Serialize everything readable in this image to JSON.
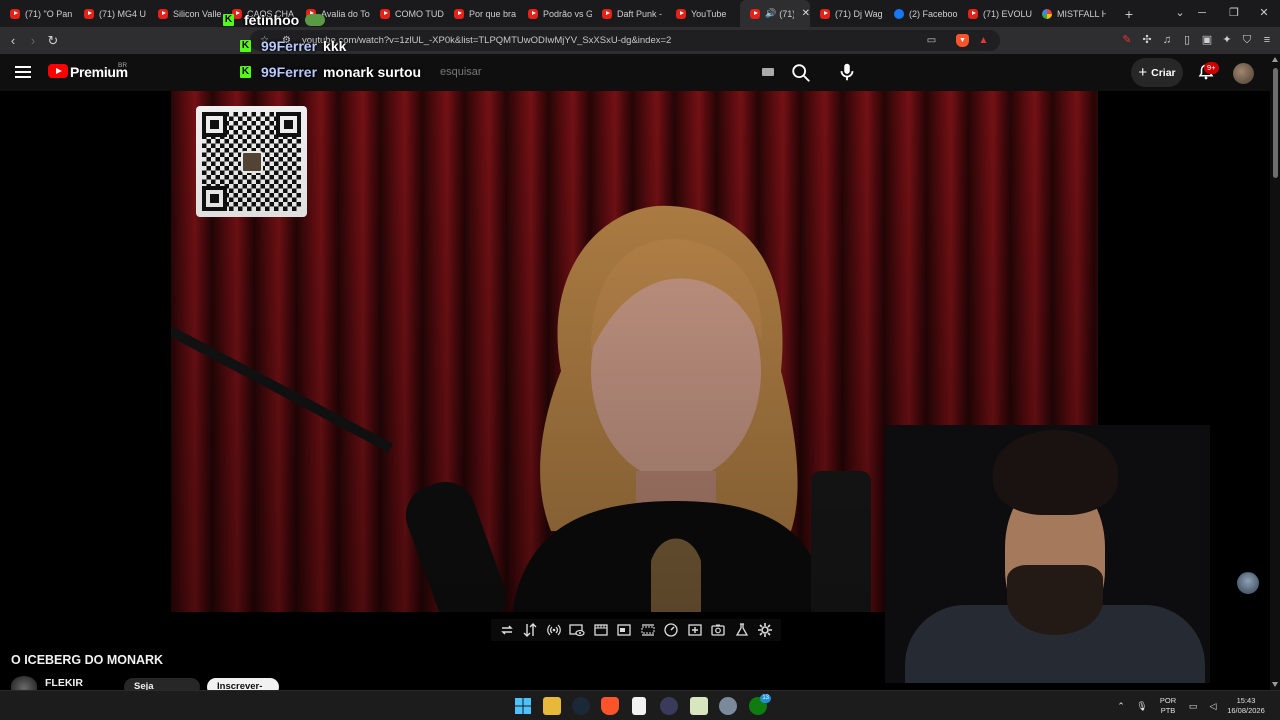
{
  "browser": {
    "tabs": [
      {
        "label": "(71) \"O Pan",
        "icon": "youtube-icon"
      },
      {
        "label": "(71) MG4 U",
        "icon": "youtube-icon"
      },
      {
        "label": "Silicon Valle",
        "icon": "youtube-icon"
      },
      {
        "label": "CAOS CHA",
        "icon": "youtube-icon"
      },
      {
        "label": "Avalia do To",
        "icon": "youtube-icon"
      },
      {
        "label": "COMO TUD",
        "icon": "youtube-icon"
      },
      {
        "label": "Por que bra",
        "icon": "youtube-icon"
      },
      {
        "label": "Podrão vs G",
        "icon": "youtube-icon"
      },
      {
        "label": "Daft Punk -",
        "icon": "youtube-icon"
      },
      {
        "label": "YouTube",
        "icon": "youtube-icon"
      },
      {
        "label": "(71)",
        "icon": "youtube-icon",
        "active": true
      },
      {
        "label": "(71) Dj Wag",
        "icon": "youtube-icon"
      },
      {
        "label": "(2) Faceboo",
        "icon": "facebook-icon"
      },
      {
        "label": "(71) EVOLU",
        "icon": "youtube-icon"
      },
      {
        "label": "MISTFALL H",
        "icon": "google-icon"
      }
    ],
    "new_tab": "+",
    "url": "youtube.com/watch?v=1zlUL_-XP0k&list=TLPQMTUwODIwMjYV_SxXSxU-dg&index=2"
  },
  "youtube": {
    "logo_text": "Premium",
    "country_code": "BR",
    "search_placeholder": "esquisar",
    "create_label": "Criar",
    "notification_count": "9+",
    "video_title": "O ICEBERG DO MONARK",
    "channel_name": "FLEKIR",
    "join_label": "Seja membro",
    "subscribe_label": "Inscrever-se"
  },
  "chat": [
    {
      "user": "fetinhoo",
      "message": ""
    },
    {
      "user": "99Ferrer",
      "message": "kkk"
    },
    {
      "user": "99Ferrer",
      "message": "monark surtou"
    }
  ],
  "player_toolbar": {
    "icons": [
      "loop-icon",
      "sort-icon",
      "audio-wave-icon",
      "eye-icon",
      "film-icon",
      "crop-icon",
      "frames-icon",
      "speed-icon",
      "add-frame-icon",
      "camera-icon",
      "flask-icon",
      "gear-icon"
    ]
  },
  "taskbar": {
    "icons": [
      "windows-start-icon",
      "file-explorer-icon",
      "steam-icon",
      "brave-icon",
      "notepad-icon",
      "app-icon",
      "calendar-icon",
      "settings-icon",
      "xbox-icon"
    ],
    "badges": {
      "notepad": "",
      "xbox": "13"
    },
    "language": "POR",
    "keyboard": "PTB",
    "time": "15:43",
    "date": "16/08/2026"
  },
  "colors": {
    "kick_green": "#53fc18",
    "youtube_red": "#ff0000",
    "curtain_red": "#7a1216"
  }
}
